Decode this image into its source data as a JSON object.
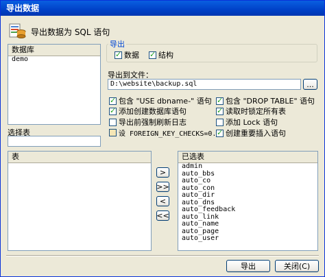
{
  "window": {
    "title": "导出数据"
  },
  "header": {
    "title": "导出数据为 SQL 语句"
  },
  "database_list": {
    "header": "数据库",
    "items": [
      "demo"
    ]
  },
  "export_group": {
    "label": "导出",
    "data_label": "数据",
    "data_checked": true,
    "structure_label": "结构",
    "structure_checked": true
  },
  "export_file": {
    "label": "导出到文件：",
    "value": "D:\\website\\backup.sql",
    "browse_label": "..."
  },
  "options": [
    {
      "label": "包含 \"USE dbname-\" 语句",
      "checked": true
    },
    {
      "label": "包含 \"DROP TABLE\" 语句",
      "checked": true
    },
    {
      "label": "添加创建数据库语句",
      "checked": true
    },
    {
      "label": "读取时锁定所有表",
      "checked": true
    },
    {
      "label": "导出前强制刷新日志",
      "checked": false
    },
    {
      "label": "添加 Lock 语句",
      "checked": false
    },
    {
      "label": "设 FOREIGN_KEY_CHECKS=0.",
      "checked": false
    },
    {
      "label": "创建重要插入语句",
      "checked": true
    }
  ],
  "select_table": {
    "label": "选择表",
    "value": ""
  },
  "table_list": {
    "header": "表",
    "items": []
  },
  "selected_list": {
    "header": "已选表",
    "items": [
      "admin",
      "auto_bbs",
      "auto_co",
      "auto_con",
      "auto_dir",
      "auto_dns",
      "auto_feedback",
      "auto_link",
      "auto_name",
      "auto_page",
      "auto_user"
    ]
  },
  "move_buttons": {
    "add_one": ">",
    "add_all": ">>",
    "remove_one": "<",
    "remove_all": "<<"
  },
  "footer": {
    "export_label": "导出",
    "close_label": "关闭(C)"
  }
}
